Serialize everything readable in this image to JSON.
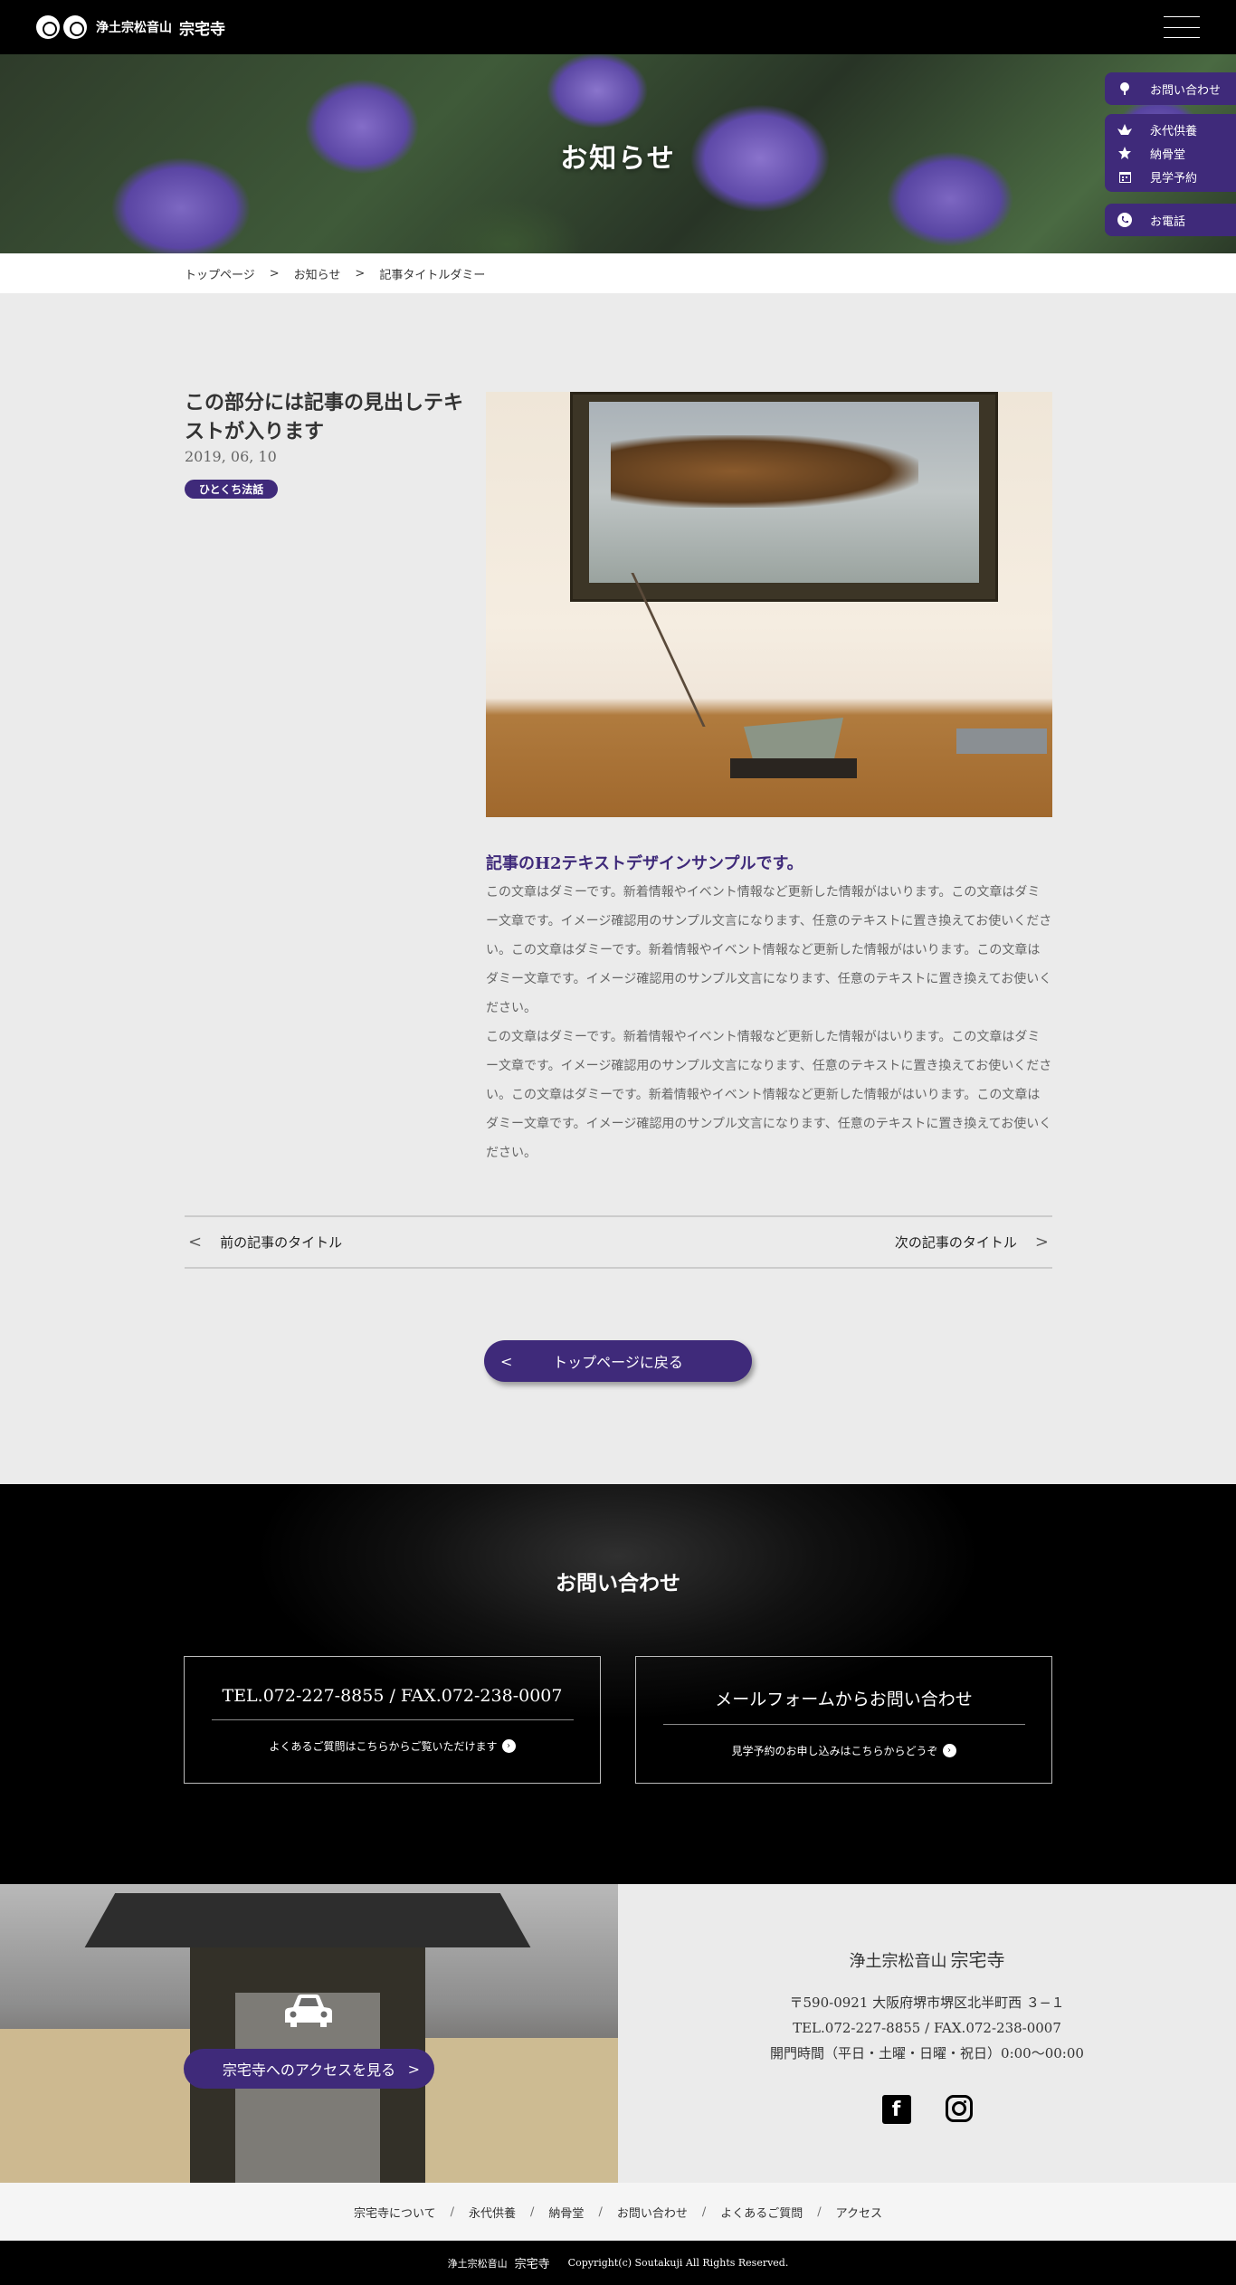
{
  "header": {
    "logo_sub": "浄土宗松音山",
    "logo_main": "宗宅寺"
  },
  "hero": {
    "title": "お知らせ"
  },
  "side_nav": {
    "contact": "お問い合わせ",
    "eitai": "永代供養",
    "nokotsudo": "納骨堂",
    "visit": "見学予約",
    "phone": "お電話"
  },
  "breadcrumb": {
    "items": [
      "トップページ",
      "お知らせ",
      "記事タイトルダミー"
    ],
    "separator": ">"
  },
  "article": {
    "title": "この部分には記事の見出しテキストが入ります",
    "date": "2019, 06, 10",
    "category": "ひとくち法話",
    "h2": "記事のH2テキストデザインサンプルです。",
    "paragraphs": [
      "この文章はダミーです。新着情報やイベント情報など更新した情報がはいります。この文章はダミー文章です。イメージ確認用のサンプル文言になります、任意のテキストに置き換えてお使いください。この文章はダミーです。新着情報やイベント情報など更新した情報がはいります。この文章はダミー文章です。イメージ確認用のサンプル文言になります、任意のテキストに置き換えてお使いください。",
      "この文章はダミーです。新着情報やイベント情報など更新した情報がはいります。この文章はダミー文章です。イメージ確認用のサンプル文言になります、任意のテキストに置き換えてお使いください。この文章はダミーです。新着情報やイベント情報など更新した情報がはいります。この文章はダミー文章です。イメージ確認用のサンプル文言になります、任意のテキストに置き換えてお使いください。"
    ]
  },
  "pager": {
    "prev_arrow": "<",
    "prev_label": "前の記事のタイトル",
    "next_label": "次の記事のタイトル",
    "next_arrow": ">"
  },
  "back_button": {
    "arrow": "<",
    "label": "トップページに戻る"
  },
  "contact": {
    "title": "お問い合わせ",
    "tel_box": {
      "title": "TEL.072-227-8855 / FAX.072-238-0007",
      "sub": "よくあるご質問はこちらからご覧いただけます"
    },
    "form_box": {
      "title": "メールフォームからお問い合わせ",
      "sub": "見学予約のお申し込みはこちらからどうぞ"
    }
  },
  "access": {
    "button": "宗宅寺へのアクセスを見る",
    "arrow": ">"
  },
  "info": {
    "name_prefix": "浄土宗松音山",
    "name": "宗宅寺",
    "address": "〒590-0921 大阪府堺市堺区北半町西 ３−１",
    "tel": "TEL.072-227-8855 / FAX.072-238-0007",
    "hours": "開門時間（平日・土曜・日曜・祝日）0:00〜00:00"
  },
  "footer_nav": {
    "items": [
      "宗宅寺について",
      "永代供養",
      "納骨堂",
      "お問い合わせ",
      "よくあるご質問",
      "アクセス"
    ],
    "separator": "/"
  },
  "copyright": {
    "name_prefix": "浄土宗松音山",
    "name": "宗宅寺",
    "text": "Copyright(c) Soutakuji All Rights Reserved."
  },
  "colors": {
    "brand_purple": "#3f2a7a",
    "header_bg": "#000000",
    "page_bg": "#ebebeb"
  }
}
